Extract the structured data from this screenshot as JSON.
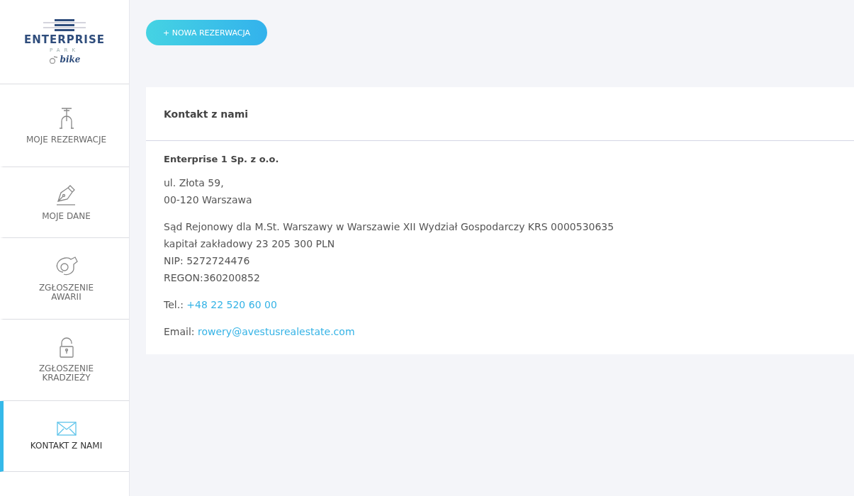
{
  "logo": {
    "name": "ENTERPRISE",
    "sub": "PARK",
    "tag": "bike"
  },
  "sidebar": {
    "items": [
      {
        "label": "MOJE REZERWACJE",
        "selected": false
      },
      {
        "label": "MOJE DANE",
        "selected": false
      },
      {
        "label": "ZGŁOSZENIE AWARII",
        "selected": false
      },
      {
        "label": "ZGŁOSZENIE KRADZIEŻY",
        "selected": false
      },
      {
        "label": "KONTAKT Z NAMI",
        "selected": true
      }
    ]
  },
  "new_button": "+ NOWA REZERWACJA",
  "card": {
    "title": "Kontakt z nami",
    "company": "Enterprise 1 Sp. z o.o.",
    "blocks": [
      {
        "lines": [
          "ul. Złota 59,",
          "00-120 Warszawa"
        ]
      },
      {
        "lines": [
          "Sąd Rejonowy dla M.St. Warszawy w Warszawie XII Wydział Gospodarczy KRS 0000530635",
          "kapitał zakładowy 23 205 300 PLN",
          "NIP: 5272724476",
          "REGON:360200852"
        ]
      }
    ],
    "contacts": [
      {
        "label": "Tel.:",
        "value": "+48 22 520 60 00"
      },
      {
        "label": "Email:",
        "value": "rowery@avestusrealestate.com"
      }
    ]
  }
}
